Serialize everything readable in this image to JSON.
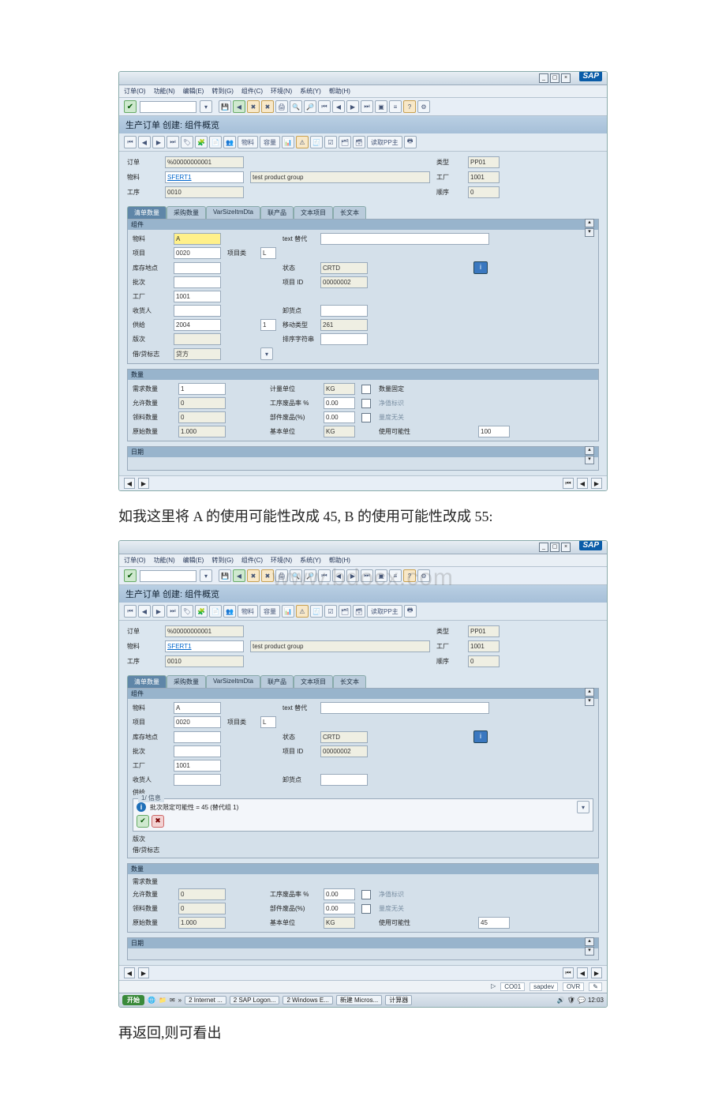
{
  "brand": "SAP",
  "watermark": "www.bdocx.com",
  "menu": [
    "订单(O)",
    "功能(N)",
    "编辑(E)",
    "转到(G)",
    "组件(C)",
    "环境(N)",
    "系统(Y)",
    "帮助(H)"
  ],
  "screen_title": "生产订单 创建: 组件概览",
  "header": {
    "order_lbl": "订单",
    "order_val": "%00000000001",
    "mat_lbl": "物料",
    "mat_val": "SFERT1",
    "mat_desc": "test product group",
    "oper_lbl": "工序",
    "oper_val": "0010",
    "type_lbl": "类型",
    "type_val": "PP01",
    "plant_lbl": "工厂",
    "plant_val": "1001",
    "seq_lbl": "顺序",
    "seq_val": "0"
  },
  "tabs": [
    "清单数量",
    "采购数量",
    "VarSizeItmDta",
    "联产品",
    "文本项目",
    "长文本"
  ],
  "comp": {
    "section": "组件",
    "mat_lbl": "物料",
    "mat_val": "A",
    "alt_lbl": "text 替代",
    "item_lbl": "项目",
    "item_val": "0020",
    "itemcat_lbl": "项目类",
    "itemcat_val": "L",
    "sloc_lbl": "库存地点",
    "status_lbl": "状态",
    "status_val": "CRTD",
    "batch_lbl": "批次",
    "itemid_lbl": "项目 ID",
    "itemid_val": "00000002",
    "plant_lbl": "工厂",
    "plant_val": "1001",
    "recip_lbl": "收货人",
    "unload_lbl": "卸货点",
    "supply_lbl": "供给",
    "supply_val": "2004",
    "supply_seq": "1",
    "mvt_lbl": "移动类型",
    "mvt_val": "261",
    "rev_lbl": "版次",
    "sort_lbl": "排序字符串",
    "ind_lbl": "借/贷标志",
    "ind_val": "贷方"
  },
  "qty": {
    "section": "数量",
    "req_lbl": "需求数量",
    "req_val": "1",
    "uom_lbl": "计量单位",
    "uom_val": "KG",
    "fix_lbl": "数量固定",
    "net_lbl": "允许数量",
    "net_val": "0",
    "scrap_lbl": "工序废品率 %",
    "scrap_val": "0.00",
    "net_chk": "净值标识",
    "wd_lbl": "领料数量",
    "wd_val": "0",
    "compscrap_lbl": "部件废品(%)",
    "compscrap_val": "0.00",
    "dim_chk": "量度无关",
    "orig_lbl": "原始数量",
    "orig_val": "1.000",
    "base_lbl": "基本单位",
    "base_val": "KG",
    "usage_lbl": "使用可能性",
    "usage_val": "100"
  },
  "dates_section": "日期",
  "doc_line1": "如我这里将 A 的使用可能性改成 45, B 的使用可能性改成 55:",
  "doc_line2": "再返回,则可看出",
  "msg": {
    "box_title": "1/ 信息",
    "text": "批次限定可能性 = 45 (替代组 1)",
    "usage_val2": "45"
  },
  "status": {
    "tcode": "CO01",
    "client": "sapdev",
    "mode": "OVR"
  },
  "taskbar": {
    "start": "开始",
    "items": [
      "2 Internet ...",
      "2 SAP Logon...",
      "2 Windows E...",
      "新建 Micros...",
      "计算器"
    ],
    "clock": "12:03"
  }
}
